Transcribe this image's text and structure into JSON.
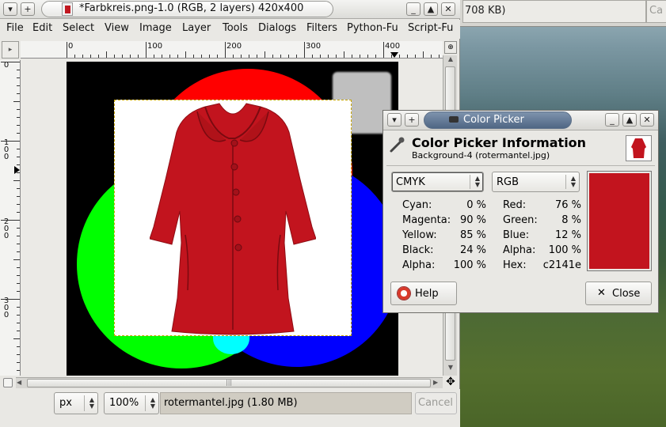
{
  "background_window": {
    "field_text": "708 KB)",
    "button_text": "Ca"
  },
  "image_window": {
    "title": "*Farbkreis.png-1.0 (RGB, 2 layers) 420x400",
    "menus": [
      "File",
      "Edit",
      "Select",
      "View",
      "Image",
      "Layer",
      "Tools",
      "Dialogs",
      "Filters",
      "Python-Fu",
      "Script-Fu"
    ],
    "hruler_labels": [
      "0",
      "100",
      "200",
      "300",
      "400"
    ],
    "vruler_labels": [
      "0",
      "100",
      "200",
      "300"
    ],
    "status": {
      "unit": "px",
      "zoom": "100%",
      "message": "rotermantel.jpg (1.80 MB)",
      "cancel_label": "Cancel"
    }
  },
  "color_picker": {
    "window_title": "Color Picker",
    "header_title": "Color Picker Information",
    "header_subtitle": "Background-4 (rotermantel.jpg)",
    "mode_left": "CMYK",
    "mode_right": "RGB",
    "cmyk": [
      {
        "label": "Cyan:",
        "value": "0 %"
      },
      {
        "label": "Magenta:",
        "value": "90 %"
      },
      {
        "label": "Yellow:",
        "value": "85 %"
      },
      {
        "label": "Black:",
        "value": "24 %"
      },
      {
        "label": "Alpha:",
        "value": "100 %"
      }
    ],
    "rgb": [
      {
        "label": "Red:",
        "value": "76 %"
      },
      {
        "label": "Green:",
        "value": "8 %"
      },
      {
        "label": "Blue:",
        "value": "12 %"
      },
      {
        "label": "Alpha:",
        "value": "100 %"
      },
      {
        "label": "Hex:",
        "value": "c2141e"
      }
    ],
    "swatch_color": "#c2141e",
    "help_label": "Help",
    "close_label": "Close"
  },
  "colors": {
    "coat_red": "#c2141e",
    "title_active": "#4f6684"
  }
}
